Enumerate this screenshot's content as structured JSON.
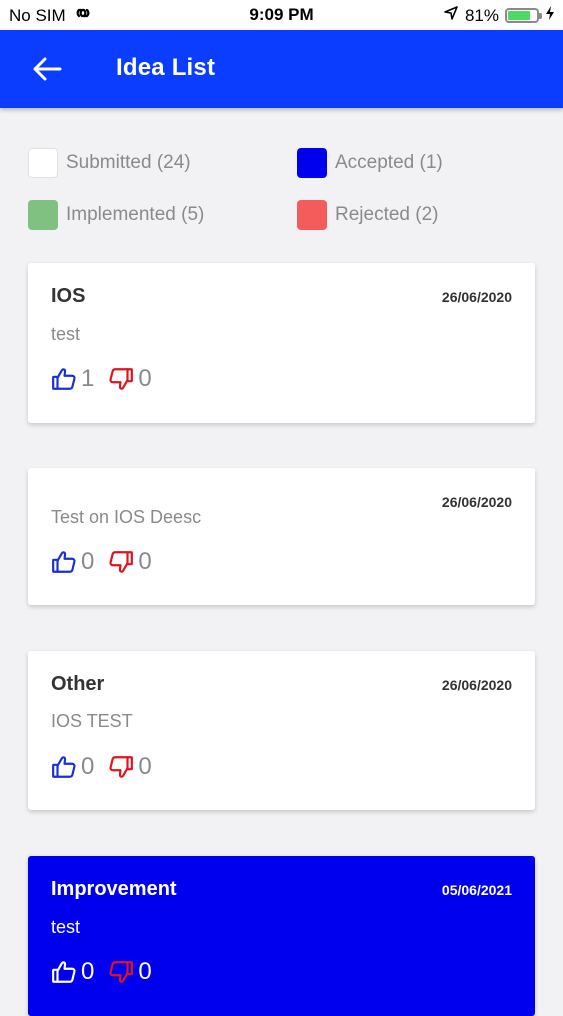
{
  "status_bar": {
    "carrier": "No SIM",
    "time": "9:09 PM",
    "battery": "81%",
    "battery_level": 0.81
  },
  "header": {
    "title": "Idea List",
    "back_icon": "arrow-left-icon",
    "color": "#0a3dff"
  },
  "legend": [
    {
      "label": "Submitted (24)",
      "color": "#ffffff"
    },
    {
      "label": "Accepted (1)",
      "color": "#0000ee"
    },
    {
      "label": "Implemented (5)",
      "color": "#80c080"
    },
    {
      "label": "Rejected (2)",
      "color": "#f45c5c"
    }
  ],
  "ideas": [
    {
      "title": "IOS",
      "date": "26/06/2020",
      "description": "test",
      "likes": "1",
      "dislikes": "0",
      "status": "submitted"
    },
    {
      "title": "",
      "date": "26/06/2020",
      "description": "Test on IOS Deesc",
      "likes": "0",
      "dislikes": "0",
      "status": "submitted"
    },
    {
      "title": "Other",
      "date": "26/06/2020",
      "description": "IOS TEST",
      "likes": "0",
      "dislikes": "0",
      "status": "submitted"
    },
    {
      "title": "Improvement",
      "date": "05/06/2021",
      "description": "test",
      "likes": "0",
      "dislikes": "0",
      "status": "accepted"
    }
  ],
  "icons": {
    "like": "thumbs-up-icon",
    "dislike": "thumbs-down-icon",
    "like_color": "#1a2fd6",
    "dislike_color": "#e0141e"
  }
}
